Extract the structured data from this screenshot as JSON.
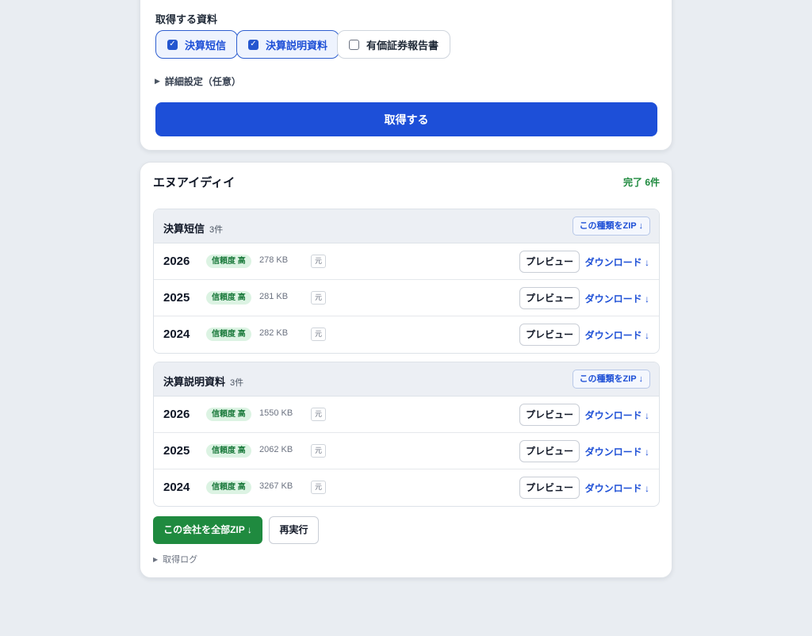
{
  "fetch_form": {
    "section_label": "取得する資料",
    "doc_types": [
      {
        "label": "決算短信",
        "checked": true
      },
      {
        "label": "決算説明資料",
        "checked": true
      },
      {
        "label": "有価証券報告書",
        "checked": false
      }
    ],
    "advanced_label": "詳細設定（任意）",
    "submit_label": "取得する"
  },
  "result": {
    "company": "エヌアイディイ",
    "status": "完了 6件",
    "groups": [
      {
        "title": "決算短信",
        "count": "3件",
        "zip_label": "この種類をZIP ↓",
        "rows": [
          {
            "year": "2026",
            "badge": "信頼度 高",
            "size": "278 KB",
            "src": "元",
            "preview": "プレビュー",
            "download": "ダウンロード ↓"
          },
          {
            "year": "2025",
            "badge": "信頼度 高",
            "size": "281 KB",
            "src": "元",
            "preview": "プレビュー",
            "download": "ダウンロード ↓"
          },
          {
            "year": "2024",
            "badge": "信頼度 高",
            "size": "282 KB",
            "src": "元",
            "preview": "プレビュー",
            "download": "ダウンロード ↓"
          }
        ]
      },
      {
        "title": "決算説明資料",
        "count": "3件",
        "zip_label": "この種類をZIP ↓",
        "rows": [
          {
            "year": "2026",
            "badge": "信頼度 高",
            "size": "1550 KB",
            "src": "元",
            "preview": "プレビュー",
            "download": "ダウンロード ↓"
          },
          {
            "year": "2025",
            "badge": "信頼度 高",
            "size": "2062 KB",
            "src": "元",
            "preview": "プレビュー",
            "download": "ダウンロード ↓"
          },
          {
            "year": "2024",
            "badge": "信頼度 高",
            "size": "3267 KB",
            "src": "元",
            "preview": "プレビュー",
            "download": "ダウンロード ↓"
          }
        ]
      }
    ],
    "all_zip_label": "この会社を全部ZIP ↓",
    "rerun_label": "再実行",
    "log_label": "取得ログ"
  },
  "colors": {
    "primary": "#1d4fd8",
    "success": "#1f8a3f",
    "background": "#e9edf2"
  }
}
